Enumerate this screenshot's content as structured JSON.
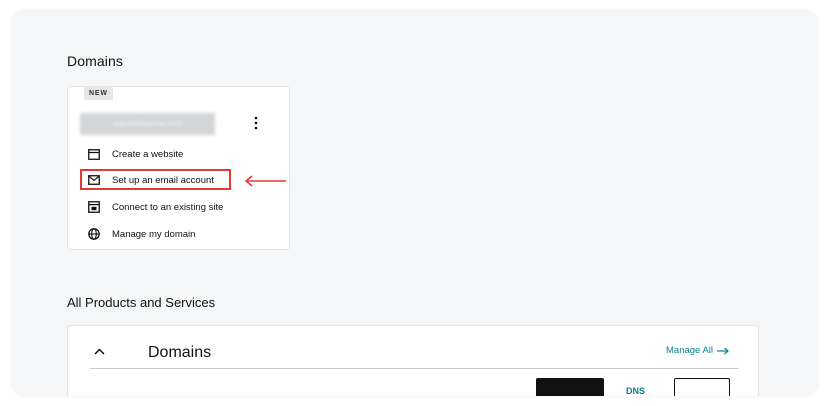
{
  "domains_section": {
    "title": "Domains",
    "card": {
      "badge": "NEW",
      "domain_name": "supreethkumar.com",
      "actions": [
        {
          "label": "Create a website",
          "icon": "browser-window-icon"
        },
        {
          "label": "Set up an email account",
          "icon": "envelope-icon"
        },
        {
          "label": "Connect to an existing site",
          "icon": "link-site-icon"
        },
        {
          "label": "Manage my domain",
          "icon": "globe-icon"
        }
      ]
    }
  },
  "annotation": {
    "highlight_color": "#e53935",
    "highlighted_action": "Set up an email account"
  },
  "products_section": {
    "title": "All Products and Services",
    "card": {
      "title": "Domains",
      "manage_all_label": "Manage All",
      "dns_label": "DNS"
    }
  },
  "colors": {
    "accent": "#0c7f8f",
    "background": "#f5f6f7",
    "card": "#ffffff"
  }
}
